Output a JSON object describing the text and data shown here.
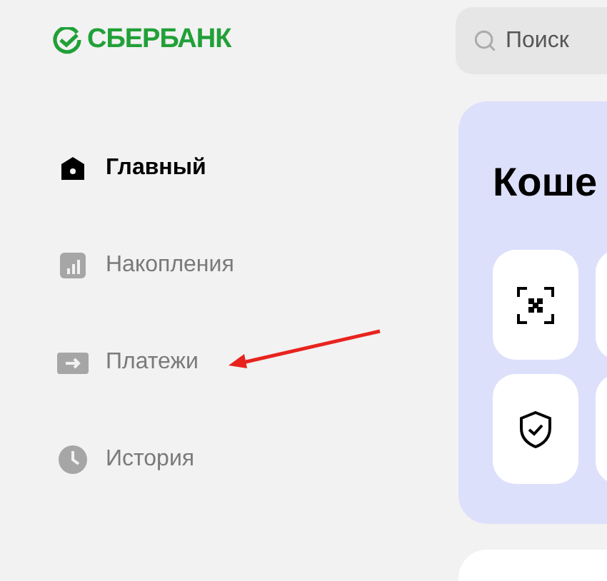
{
  "logo": {
    "text": "СБЕРБАНК"
  },
  "search": {
    "placeholder": "Поиск"
  },
  "nav": [
    {
      "label": "Главный",
      "selected": true
    },
    {
      "label": "Накопления",
      "selected": false
    },
    {
      "label": "Платежи",
      "selected": false
    },
    {
      "label": "История",
      "selected": false
    }
  ],
  "wallet": {
    "title": "Коше"
  }
}
